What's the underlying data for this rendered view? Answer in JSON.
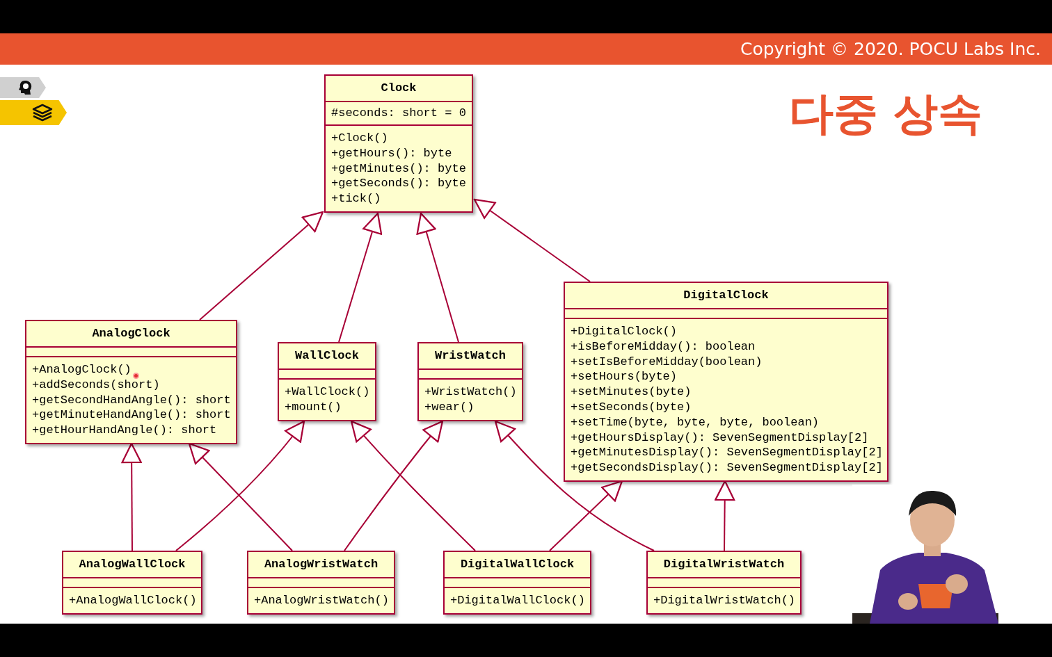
{
  "banner": {
    "copyright": "Copyright © 2020. POCU Labs Inc."
  },
  "slide": {
    "title": "다중 상속"
  },
  "classes": [
    {
      "name": "Clock",
      "attributes": [
        "#seconds: short = 0"
      ],
      "methods": [
        "+Clock()",
        "+getHours(): byte",
        "+getMinutes(): byte",
        "+getSeconds(): byte",
        "+tick()"
      ]
    },
    {
      "name": "AnalogClock",
      "methods": [
        "+AnalogClock()",
        "+addSeconds(short)",
        "+getSecondHandAngle(): short",
        "+getMinuteHandAngle(): short",
        "+getHourHandAngle(): short"
      ]
    },
    {
      "name": "WallClock",
      "methods": [
        "+WallClock()",
        "+mount()"
      ]
    },
    {
      "name": "WristWatch",
      "methods": [
        "+WristWatch()",
        "+wear()"
      ]
    },
    {
      "name": "DigitalClock",
      "methods": [
        "+DigitalClock()",
        "+isBeforeMidday(): boolean",
        "+setIsBeforeMidday(boolean)",
        "+setHours(byte)",
        "+setMinutes(byte)",
        "+setSeconds(byte)",
        "+setTime(byte, byte, byte, boolean)",
        "+getHoursDisplay(): SevenSegmentDisplay[2]",
        "+getMinutesDisplay(): SevenSegmentDisplay[2]",
        "+getSecondsDisplay(): SevenSegmentDisplay[2]"
      ]
    },
    {
      "name": "AnalogWallClock",
      "methods": [
        "+AnalogWallClock()"
      ]
    },
    {
      "name": "AnalogWristWatch",
      "methods": [
        "+AnalogWristWatch()"
      ]
    },
    {
      "name": "DigitalWallClock",
      "methods": [
        "+DigitalWallClock()"
      ]
    },
    {
      "name": "DigitalWristWatch",
      "methods": [
        "+DigitalWristWatch()"
      ]
    }
  ]
}
